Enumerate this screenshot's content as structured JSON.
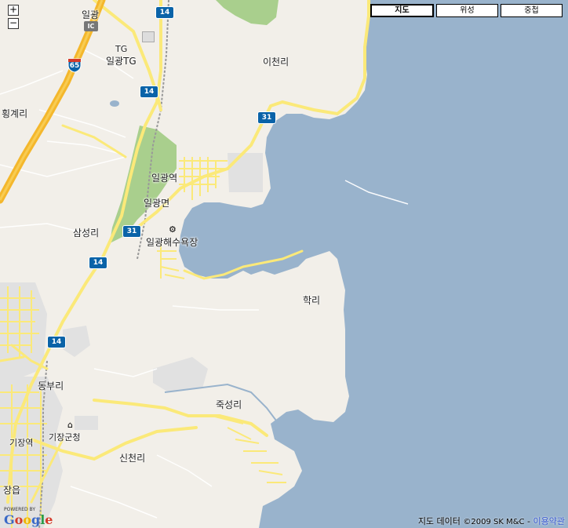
{
  "controls": {
    "zoom_in": "+",
    "zoom_out": "−",
    "map_types": [
      "지도",
      "위성",
      "중첩"
    ],
    "active_map_type": "지도"
  },
  "places": {
    "ilgwang_top": "일광",
    "tg": "TG",
    "ilgwang_tg": "일광TG",
    "icheon_ri": "이천리",
    "hwanggye_ri": "횡계리",
    "ilgwang_station": "일광역",
    "ilgwang_myeon": "일광면",
    "samseong_ri": "삼성리",
    "ilgwang_beach": "일광해수욕장",
    "hak_ri": "학리",
    "dongbu_ri": "동부리",
    "jukseong_ri": "죽성리",
    "gijang_gun_office": "기장군청",
    "gijang_station": "기장역",
    "sincheon_ri": "신천리",
    "jangeup": "장읍"
  },
  "shields": {
    "interstate_65": "65",
    "route_14": "14",
    "route_31": "31",
    "ic": "IC"
  },
  "attribution": {
    "powered_by": "POWERED BY",
    "logo": "Google",
    "data_label": "지도 데이터",
    "copyright": "©2009 SK M&C",
    "separator": " - ",
    "terms_link": "이용약관"
  },
  "colors": {
    "land": "#f2efe9",
    "water": "#99b3cc",
    "park": "#a9cf8d",
    "urban": "#e1e1e1",
    "highway": "#f4b72c",
    "road": "#fbe979",
    "shield_blue": "#0a63a8"
  }
}
